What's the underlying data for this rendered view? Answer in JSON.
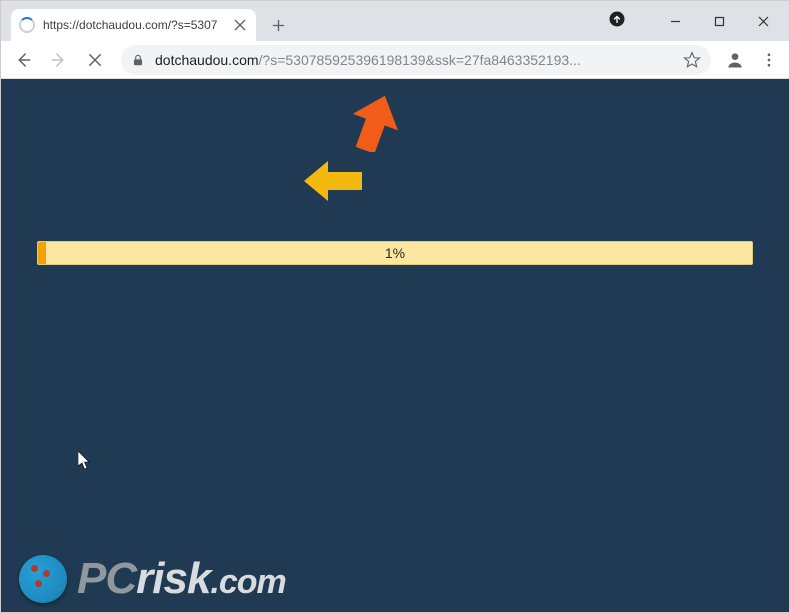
{
  "tab": {
    "title": "https://dotchaudou.com/?s=5307"
  },
  "url": {
    "domain": "dotchaudou.com",
    "path": "/?s=530785925396198139&ssk=27fa8463352193..."
  },
  "content": {
    "progress_text": "1%"
  },
  "watermark": {
    "pc": "PC",
    "risk": "risk",
    "com": ".com"
  }
}
